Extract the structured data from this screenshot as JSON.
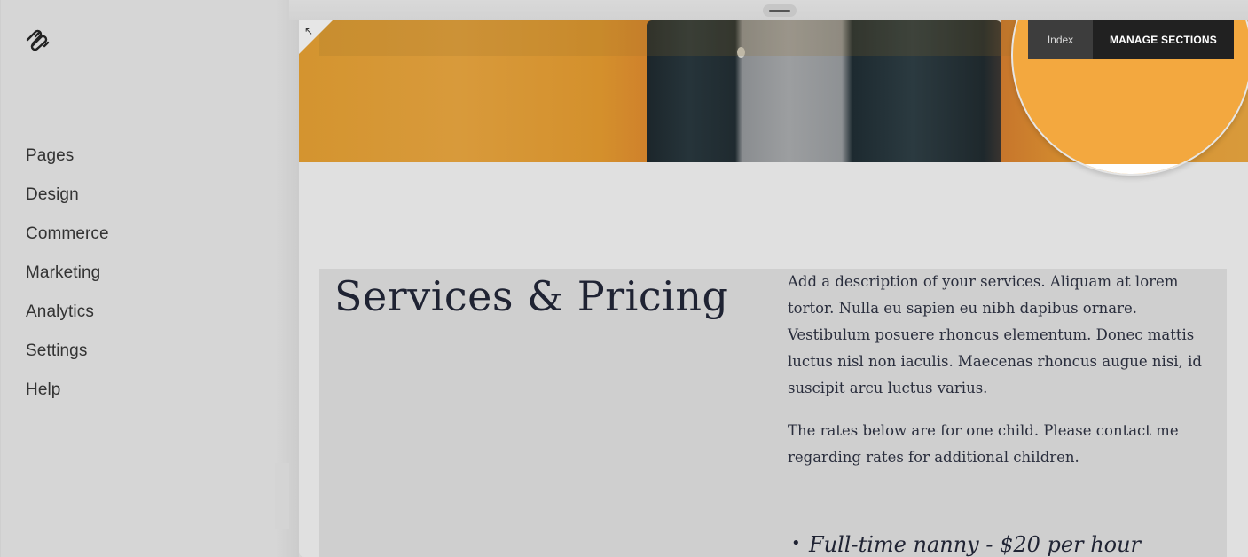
{
  "sidebar": {
    "logo": "squarespace-logo",
    "items": [
      {
        "label": "Pages"
      },
      {
        "label": "Design"
      },
      {
        "label": "Commerce"
      },
      {
        "label": "Marketing"
      },
      {
        "label": "Analytics"
      },
      {
        "label": "Settings"
      },
      {
        "label": "Help"
      }
    ]
  },
  "preview": {
    "toolbar": {
      "page_label": "Index",
      "manage_label": "MANAGE SECTIONS"
    },
    "section": {
      "title": "Services & Pricing",
      "paragraphs": [
        "Add a description of your services. Aliquam at lorem tortor. Nulla eu sapien eu nibh dapibus ornare. Vestibulum posuere rhoncus elementum. Donec mattis luctus nisl non iaculis. Maecenas rhoncus augue nisi, id suscipit arcu luctus varius.",
        "The rates below are for one child. Please contact me regarding rates for additional children."
      ],
      "rates": [
        "Full-time nanny - $20 per hour"
      ]
    },
    "colors": {
      "banner_orange": "#d89a3a",
      "spotlight_orange": "#f3a83f",
      "toolbar_dark": "#212121"
    }
  }
}
